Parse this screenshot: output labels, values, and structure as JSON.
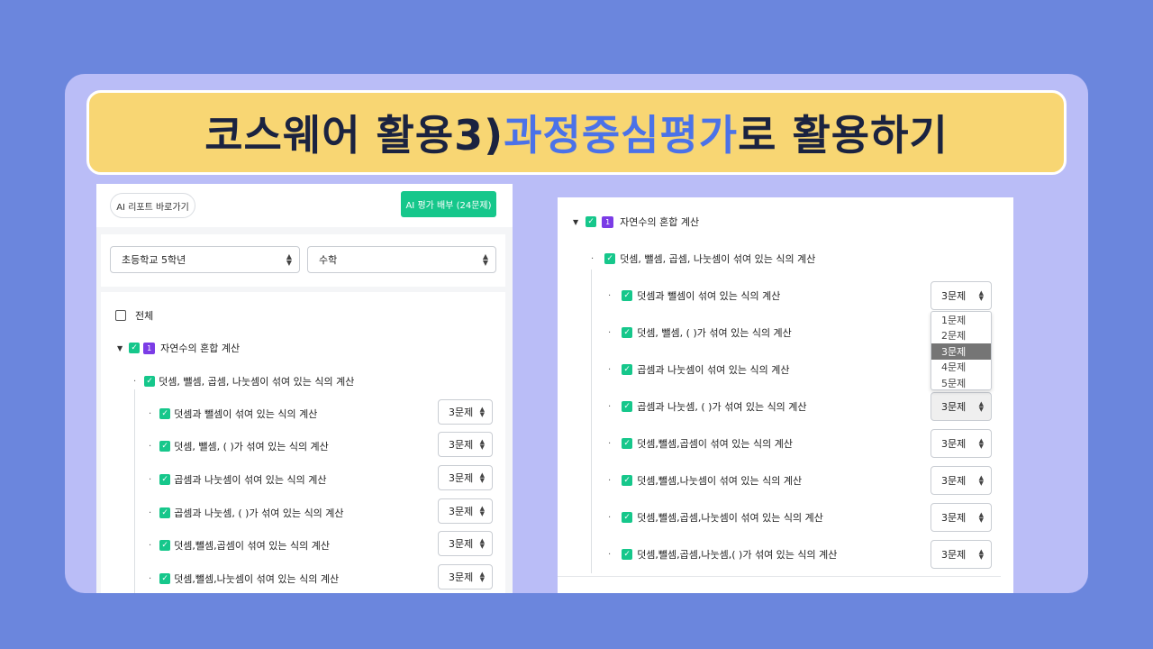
{
  "title": {
    "part1": "코스웨어 활용3) ",
    "accent": "과정중심평가",
    "part2": "로 활용하기"
  },
  "left": {
    "report_button": "AI 리포트 바로가기",
    "deploy_button": "AI 평가 배부 (24문제)",
    "grade_select": "초등학교 5학년",
    "subject_select": "수학",
    "select_all": "전체",
    "unit_number": "1",
    "unit_title": "자연수의 혼합 계산",
    "subunit": "덧셈, 뺄셈, 곱셈, 나눗셈이 섞여 있는 식의 계산",
    "items": [
      {
        "label": "덧셈과 뺄셈이 섞여 있는 식의 계산",
        "count": "3문제"
      },
      {
        "label": "덧셈, 뺄셈, ( )가 섞여 있는 식의 계산",
        "count": "3문제"
      },
      {
        "label": "곱셈과 나눗셈이 섞여 있는 식의 계산",
        "count": "3문제"
      },
      {
        "label": "곱셈과 나눗셈, ( )가 섞여 있는 식의 계산",
        "count": "3문제"
      },
      {
        "label": "덧셈,뺄셈,곱셈이 섞여 있는 식의 계산",
        "count": "3문제"
      },
      {
        "label": "덧셈,뺄셈,나눗셈이 섞여 있는 식의 계산",
        "count": "3문제"
      }
    ]
  },
  "right": {
    "unit_number": "1",
    "unit_title": "자연수의 혼합 계산",
    "subunit": "덧셈, 뺄셈, 곱셈, 나눗셈이 섞여 있는 식의 계산",
    "items": [
      {
        "label": "덧셈과 뺄셈이 섞여 있는 식의 계산",
        "count": "3문제"
      },
      {
        "label": "덧셈, 뺄셈, ( )가 섞여 있는 식의 계산",
        "count": "3문제"
      },
      {
        "label": "곱셈과 나눗셈이 섞여 있는 식의 계산",
        "count": "3문제"
      },
      {
        "label": "곱셈과 나눗셈, ( )가 섞여 있는 식의 계산",
        "count": "3문제"
      },
      {
        "label": "덧셈,뺄셈,곱셈이 섞여 있는 식의 계산",
        "count": "3문제"
      },
      {
        "label": "덧셈,뺄셈,나눗셈이 섞여 있는 식의 계산",
        "count": "3문제"
      },
      {
        "label": "덧셈,뺄셈,곱셈,나눗셈이 섞여 있는 식의 계산",
        "count": "3문제"
      },
      {
        "label": "덧셈,뺄셈,곱셈,나눗셈,( )가 섞여 있는 식의 계산",
        "count": "3문제"
      }
    ],
    "dropdown_options": [
      "1문제",
      "2문제",
      "3문제",
      "4문제",
      "5문제"
    ],
    "dropdown_selected": "3문제"
  },
  "colors": {
    "background": "#6b86dd",
    "card": "#babdf7",
    "banner": "#f8d673",
    "accent": "#4b72e8",
    "check": "#16c78b",
    "badge": "#7b3ce6"
  },
  "icons": {
    "checkbox": "check-icon",
    "expand": "caret-down-icon",
    "select_arrow": "updown-chevron-icon"
  }
}
